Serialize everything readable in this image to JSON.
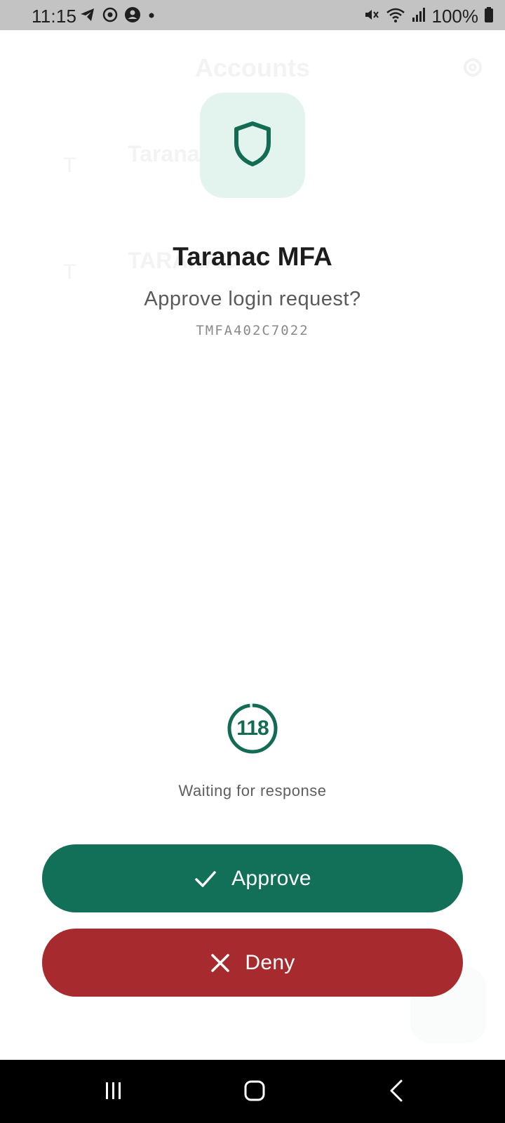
{
  "status_bar": {
    "time": "11:15",
    "battery": "100%",
    "left_icons": [
      "telegram-icon",
      "sync-icon",
      "account-icon",
      "dot-icon"
    ],
    "right_icons": [
      "mute-icon",
      "wifi-icon",
      "signal-icon",
      "battery-icon"
    ]
  },
  "background_screen": {
    "title": "Accounts",
    "accounts": [
      {
        "name": "Taranac",
        "initial": "T"
      },
      {
        "name": "TARANAC",
        "initial": "T"
      }
    ]
  },
  "dialog": {
    "app_name": "Taranac MFA",
    "prompt": "Approve login request?",
    "request_code": "TMFA402C7022",
    "timer": {
      "seconds_remaining": "118",
      "fraction_remaining": 0.98
    },
    "status": "Waiting for response",
    "approve_label": "Approve",
    "deny_label": "Deny"
  },
  "colors": {
    "accent": "#126f58",
    "danger": "#a72b2e",
    "icon_tile": "#e3f4ee"
  }
}
